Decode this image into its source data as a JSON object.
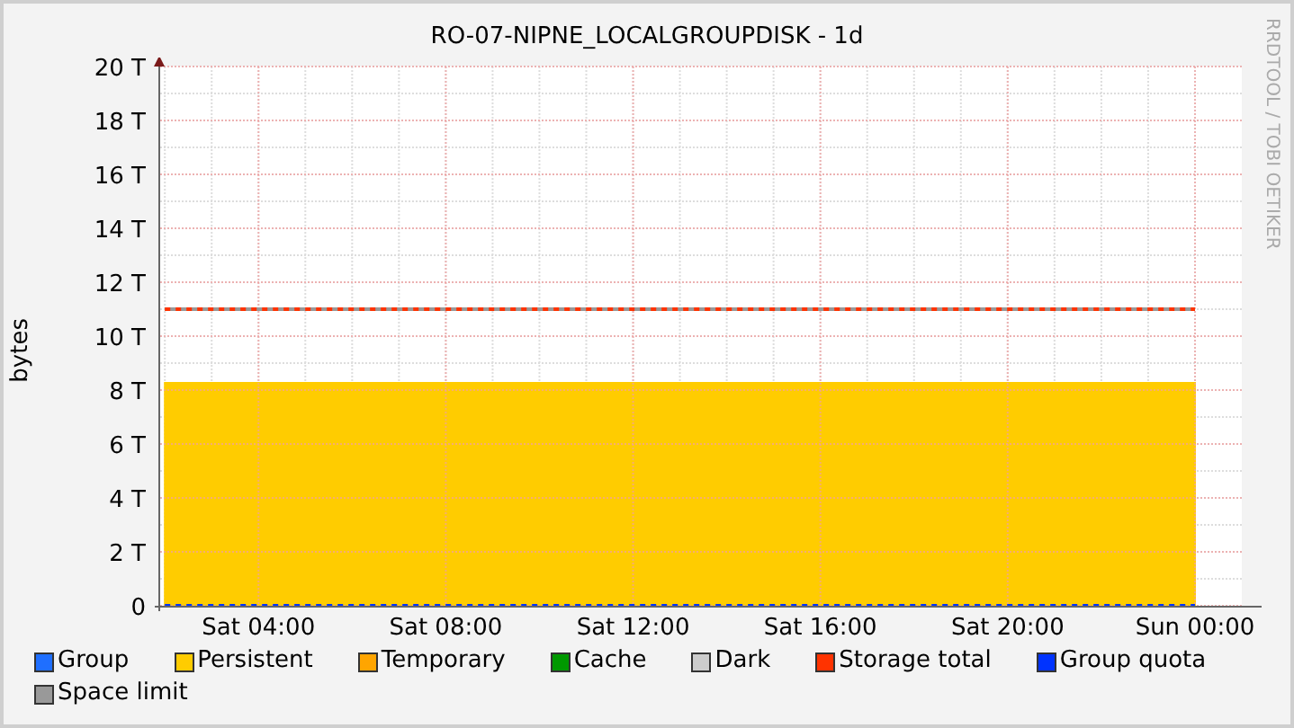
{
  "title": "RO-07-NIPNE_LOCALGROUPDISK - 1d",
  "credit": "RRDTOOL / TOBI OETIKER",
  "chart_data": {
    "type": "area",
    "grid": true,
    "ylabel": "bytes",
    "ylim": [
      0,
      20
    ],
    "categories": [
      null,
      null,
      "Sat 04:00",
      null,
      null,
      null,
      "Sat 08:00",
      null,
      null,
      null,
      "Sat 12:00",
      null,
      null,
      null,
      "Sat 16:00",
      null,
      null,
      null,
      "Sat 20:00",
      null,
      null,
      null,
      "Sun 00:00"
    ],
    "yticks": [
      {
        "value": 0,
        "label": "0"
      },
      {
        "value": 2,
        "label": "2 T"
      },
      {
        "value": 4,
        "label": "4 T"
      },
      {
        "value": 6,
        "label": "6 T"
      },
      {
        "value": 8,
        "label": "8 T"
      },
      {
        "value": 10,
        "label": "10 T"
      },
      {
        "value": 12,
        "label": "12 T"
      },
      {
        "value": 14,
        "label": "14 T"
      },
      {
        "value": 16,
        "label": "16 T"
      },
      {
        "value": 18,
        "label": "18 T"
      },
      {
        "value": 20,
        "label": "20 T"
      }
    ],
    "series": [
      {
        "name": "Group",
        "color": "#1f6fff",
        "type": "area",
        "values": [
          null,
          null,
          null,
          null,
          null,
          null,
          null,
          null,
          null,
          null,
          null,
          null,
          null,
          null,
          null,
          null,
          null,
          null,
          null,
          null,
          null,
          null,
          null
        ]
      },
      {
        "name": "Persistent",
        "color": "#ffcc00",
        "type": "area",
        "values": [
          8.27,
          8.27,
          8.27,
          8.27,
          8.27,
          8.27,
          8.27,
          8.27,
          8.27,
          8.27,
          8.27,
          8.27,
          8.27,
          8.27,
          8.27,
          8.27,
          8.27,
          8.27,
          8.27,
          8.27,
          8.27,
          8.27,
          8.27
        ]
      },
      {
        "name": "Temporary",
        "color": "#ffa500",
        "type": "area",
        "values": [
          null,
          null,
          null,
          null,
          null,
          null,
          null,
          null,
          null,
          null,
          null,
          null,
          null,
          null,
          null,
          null,
          null,
          null,
          null,
          null,
          null,
          null,
          null
        ]
      },
      {
        "name": "Cache",
        "color": "#009900",
        "type": "area",
        "values": [
          null,
          null,
          null,
          null,
          null,
          null,
          null,
          null,
          null,
          null,
          null,
          null,
          null,
          null,
          null,
          null,
          null,
          null,
          null,
          null,
          null,
          null,
          null
        ]
      },
      {
        "name": "Dark",
        "color": "#cccccc",
        "type": "area",
        "values": [
          null,
          null,
          null,
          null,
          null,
          null,
          null,
          null,
          null,
          null,
          null,
          null,
          null,
          null,
          null,
          null,
          null,
          null,
          null,
          null,
          null,
          null,
          null
        ]
      },
      {
        "name": "Storage total",
        "color": "#ff3300",
        "type": "line",
        "line_style": "dashed",
        "values": [
          11,
          11,
          11,
          11,
          11,
          11,
          11,
          11,
          11,
          11,
          11,
          11,
          11,
          11,
          11,
          11,
          11,
          11,
          11,
          11,
          11,
          11,
          11
        ]
      },
      {
        "name": "Group quota",
        "color": "#0033ff",
        "type": "line",
        "line_style": "dashed",
        "values": [
          0,
          0,
          0,
          0,
          0,
          0,
          0,
          0,
          0,
          0,
          0,
          0,
          0,
          0,
          0,
          0,
          0,
          0,
          0,
          0,
          0,
          0,
          0
        ]
      },
      {
        "name": "Space limit",
        "color": "#999999",
        "type": "line",
        "line_style": "solid",
        "values": [
          11,
          11,
          11,
          11,
          11,
          11,
          11,
          11,
          11,
          11,
          11,
          11,
          11,
          11,
          11,
          11,
          11,
          11,
          11,
          11,
          11,
          11,
          11
        ]
      }
    ]
  }
}
